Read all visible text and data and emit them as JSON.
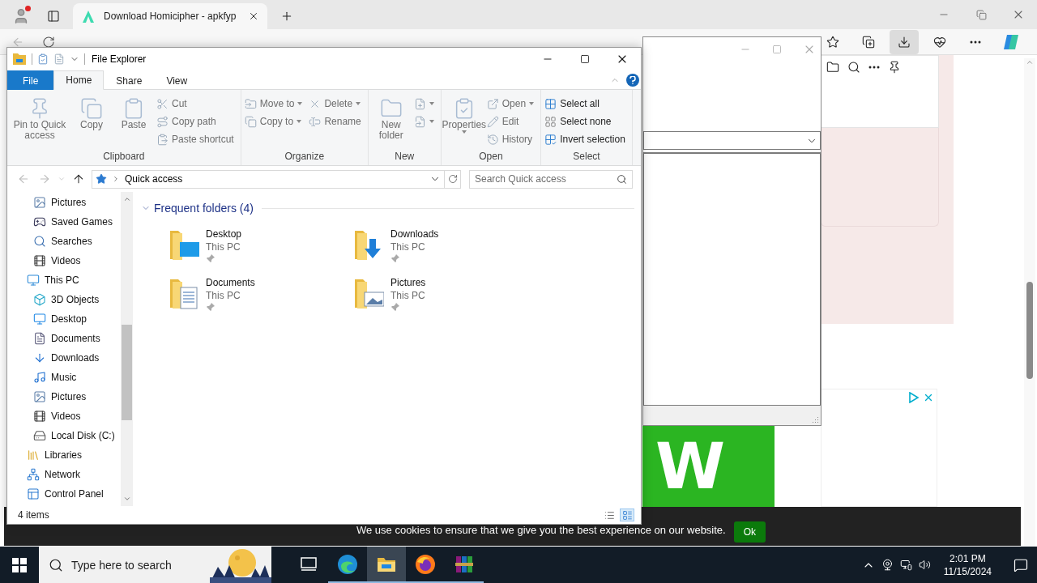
{
  "browser": {
    "tab": {
      "title": "Download Homicipher - apkfyp"
    }
  },
  "web_page": {
    "ad_banner": {
      "text": "W"
    },
    "cookie_notice": {
      "text": "We use cookies to ensure that we give you the best experience on our website.",
      "button": "Ok"
    }
  },
  "explorer": {
    "title": "File Explorer",
    "tabs": [
      {
        "label": "File",
        "kind": "file",
        "selected": false
      },
      {
        "label": "Home",
        "kind": "tab",
        "selected": true
      },
      {
        "label": "Share",
        "kind": "tab",
        "selected": false
      },
      {
        "label": "View",
        "kind": "tab",
        "selected": false
      }
    ],
    "ribbon": [
      {
        "label": "Clipboard",
        "items": [
          {
            "kind": "large",
            "label": "Pin to Quick access",
            "disabled": true
          },
          {
            "kind": "large",
            "label": "Copy",
            "disabled": true
          },
          {
            "kind": "large",
            "label": "Paste",
            "disabled": true
          },
          {
            "kind": "stack",
            "items": [
              {
                "label": "Cut",
                "disabled": true
              },
              {
                "label": "Copy path",
                "disabled": true
              },
              {
                "label": "Paste shortcut",
                "disabled": true
              }
            ]
          }
        ]
      },
      {
        "label": "Organize",
        "items": [
          {
            "kind": "stack",
            "items": [
              {
                "label": "Move to",
                "dropdown": true,
                "disabled": true
              },
              {
                "label": "Copy to",
                "dropdown": true,
                "disabled": true
              }
            ]
          },
          {
            "kind": "stack",
            "items": [
              {
                "label": "Delete",
                "dropdown": true,
                "disabled": true
              },
              {
                "label": "Rename",
                "disabled": true
              }
            ]
          }
        ]
      },
      {
        "label": "New",
        "items": [
          {
            "kind": "large",
            "label": "New folder",
            "disabled": true
          },
          {
            "kind": "stack",
            "items": [
              {
                "dropdown": true,
                "disabled": true
              },
              {
                "dropdown": true,
                "disabled": true
              }
            ]
          }
        ]
      },
      {
        "label": "Open",
        "items": [
          {
            "kind": "large",
            "label": "Properties",
            "dropdown": true,
            "disabled": true
          },
          {
            "kind": "stack",
            "items": [
              {
                "label": "Open",
                "dropdown": true,
                "disabled": true
              },
              {
                "label": "Edit",
                "disabled": true
              },
              {
                "label": "History",
                "disabled": true
              }
            ]
          }
        ]
      },
      {
        "label": "Select",
        "items": [
          {
            "kind": "stack",
            "items": [
              {
                "label": "Select all",
                "disabled": false
              },
              {
                "label": "Select none",
                "disabled": false
              },
              {
                "label": "Invert selection",
                "disabled": false
              }
            ]
          }
        ]
      }
    ],
    "address": {
      "path": "Quick access"
    },
    "search": {
      "placeholder": "Search Quick access"
    },
    "nav_tree": [
      {
        "children": [
          {
            "label": "Pictures"
          },
          {
            "label": "Saved Games"
          },
          {
            "label": "Searches"
          },
          {
            "label": "Videos"
          }
        ]
      },
      {
        "label": "This PC",
        "children": [
          {
            "label": "3D Objects"
          },
          {
            "label": "Desktop"
          },
          {
            "label": "Documents"
          },
          {
            "label": "Downloads"
          },
          {
            "label": "Music"
          },
          {
            "label": "Pictures"
          },
          {
            "label": "Videos"
          },
          {
            "label": "Local Disk (C:)"
          }
        ]
      },
      {
        "label": "Libraries"
      },
      {
        "label": "Network"
      },
      {
        "label": "Control Panel"
      }
    ],
    "section": {
      "title": "Frequent folders (4)",
      "expanded": true
    },
    "folders": [
      {
        "name": "Desktop",
        "location": "This PC"
      },
      {
        "name": "Downloads",
        "location": "This PC"
      },
      {
        "name": "Documents",
        "location": "This PC"
      },
      {
        "name": "Pictures",
        "location": "This PC"
      }
    ],
    "status_bar": {
      "item_count": "4 items"
    }
  },
  "taskbar": {
    "search_placeholder": "Type here to search",
    "apps": [
      {
        "running": false,
        "active": false
      },
      {
        "running": true,
        "active": false
      },
      {
        "running": true,
        "active": true
      },
      {
        "running": true,
        "active": false
      },
      {
        "running": true,
        "active": false
      }
    ],
    "time": "2:01 PM",
    "date": "11/15/2024"
  }
}
